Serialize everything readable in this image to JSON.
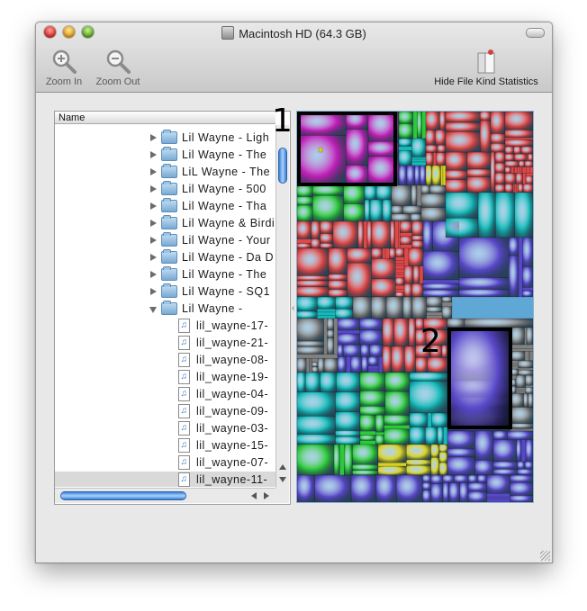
{
  "window": {
    "title": "Macintosh HD (64.3 GB)"
  },
  "toolbar": {
    "zoom_in": "Zoom In",
    "zoom_out": "Zoom Out",
    "hide_stats": "Hide File Kind Statistics"
  },
  "list": {
    "column_name": "Name",
    "rows": [
      {
        "type": "folder",
        "expanded": false,
        "label": "Lil Wayne - Ligh"
      },
      {
        "type": "folder",
        "expanded": false,
        "label": "Lil Wayne - The"
      },
      {
        "type": "folder",
        "expanded": false,
        "label": "LiL Wayne - The"
      },
      {
        "type": "folder",
        "expanded": false,
        "label": "Lil Wayne - 500"
      },
      {
        "type": "folder",
        "expanded": false,
        "label": "Lil Wayne - Tha"
      },
      {
        "type": "folder",
        "expanded": false,
        "label": "Lil Wayne & Birdi"
      },
      {
        "type": "folder",
        "expanded": false,
        "label": "Lil Wayne - Your"
      },
      {
        "type": "folder",
        "expanded": false,
        "label": "Lil Wayne - Da D"
      },
      {
        "type": "folder",
        "expanded": false,
        "label": "Lil Wayne - The"
      },
      {
        "type": "folder",
        "expanded": false,
        "label": "Lil Wayne - SQ1"
      },
      {
        "type": "folder",
        "expanded": true,
        "label": "Lil Wayne -"
      },
      {
        "type": "file",
        "label": "lil_wayne-17-"
      },
      {
        "type": "file",
        "label": "lil_wayne-21-"
      },
      {
        "type": "file",
        "label": "lil_wayne-08-"
      },
      {
        "type": "file",
        "label": "lil_wayne-19-"
      },
      {
        "type": "file",
        "label": "lil_wayne-04-"
      },
      {
        "type": "file",
        "label": "lil_wayne-09-"
      },
      {
        "type": "file",
        "label": "lil_wayne-03-"
      },
      {
        "type": "file",
        "label": "lil_wayne-15-"
      },
      {
        "type": "file",
        "label": "lil_wayne-07-"
      },
      {
        "type": "file",
        "label": "lil_wayne-11-",
        "selected": true
      }
    ]
  },
  "annotations": {
    "one": "1",
    "two": "2"
  },
  "icons": {
    "zoom_in": "magnifier-plus-icon",
    "zoom_out": "magnifier-minus-icon",
    "hide_stats": "statistics-panel-icon",
    "folder": "folder-icon",
    "file": "audio-file-icon"
  },
  "colors": {
    "treemap_magenta": "#c020b8",
    "treemap_red": "#e04848",
    "treemap_green": "#2ec83c",
    "treemap_cyan": "#16b8b8",
    "treemap_purple": "#5848c8",
    "treemap_yellow": "#d8d020",
    "treemap_gray": "#808080",
    "scroll_blue": "#3a7fd8"
  }
}
